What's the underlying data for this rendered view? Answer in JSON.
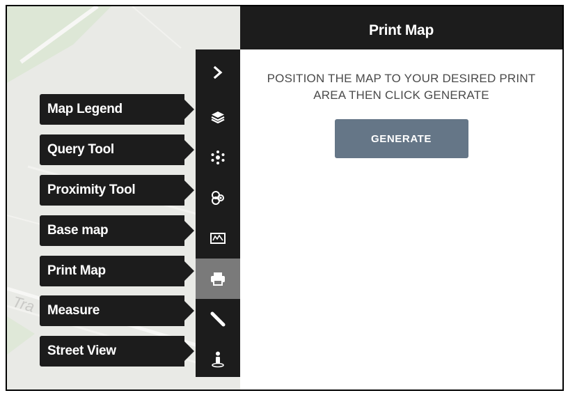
{
  "panel": {
    "title": "Print Map",
    "instructions": "POSITION THE MAP TO YOUR DESIRED PRINT AREA THEN CLICK GENERATE",
    "generate_label": "GENERATE"
  },
  "toolbar": {
    "collapse_icon": "chevron-right-icon",
    "active_item": "Print Map",
    "items": [
      {
        "label": "Map Legend",
        "icon": "layers-icon"
      },
      {
        "label": "Query Tool",
        "icon": "molecule-icon"
      },
      {
        "label": "Proximity Tool",
        "icon": "circles-icon"
      },
      {
        "label": "Base map",
        "icon": "map-icon"
      },
      {
        "label": "Print Map",
        "icon": "printer-icon"
      },
      {
        "label": "Measure",
        "icon": "ruler-icon"
      },
      {
        "label": "Street View",
        "icon": "pegman-icon"
      }
    ]
  },
  "map": {
    "street_label_fragment": "Tra"
  },
  "colors": {
    "toolbar_bg": "#1c1c1c",
    "active_bg": "#7a7a7a",
    "button_bg": "#657687",
    "map_bg": "#e9eae6"
  }
}
